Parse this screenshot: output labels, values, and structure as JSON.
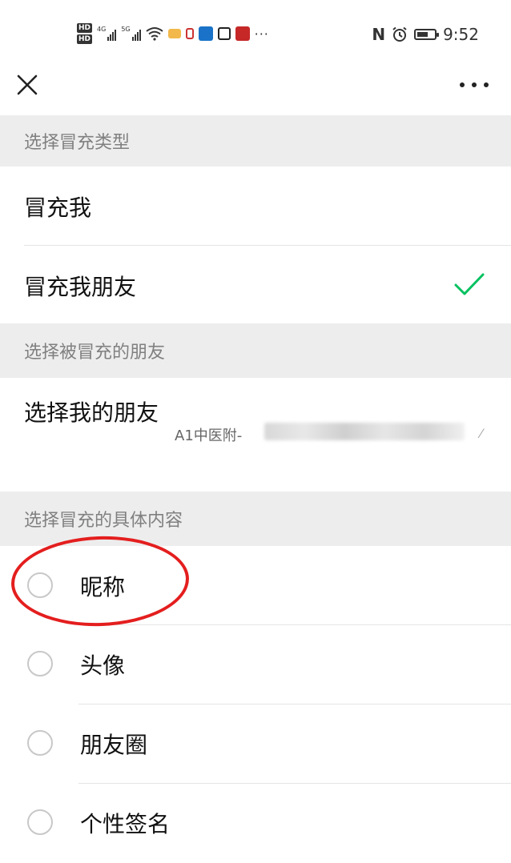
{
  "status_bar": {
    "hd_badge": "HD",
    "net_4g": "4G",
    "net_5g": "5G",
    "dots": "···",
    "nfc": "N",
    "time": "9:52"
  },
  "sections": {
    "impersonation_type": {
      "header": "选择冒充类型",
      "options": [
        {
          "label": "冒充我",
          "selected": false
        },
        {
          "label": "冒充我朋友",
          "selected": true
        }
      ]
    },
    "impersonated_friend": {
      "header": "选择被冒充的朋友",
      "label": "选择我的朋友",
      "value": "A1中医附-"
    },
    "impersonation_content": {
      "header": "选择冒充的具体内容",
      "options": [
        {
          "label": "昵称"
        },
        {
          "label": "头像"
        },
        {
          "label": "朋友圈"
        },
        {
          "label": "个性签名"
        }
      ]
    }
  },
  "colors": {
    "accent_check": "#07c160",
    "section_bg": "#ededed",
    "annotation": "#e41e1e"
  },
  "icons": {
    "close": "close-icon",
    "more": "more-icon",
    "check": "check-icon"
  }
}
